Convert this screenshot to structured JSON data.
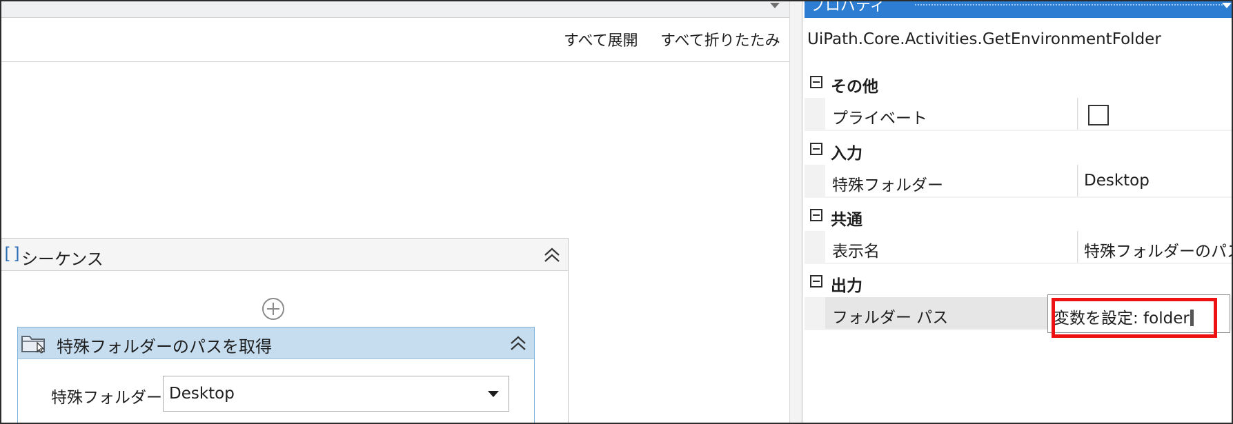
{
  "designer": {
    "expand_all": "すべて展開",
    "collapse_all": "すべて折りたたみ",
    "sequence": {
      "bracket": "[]",
      "title": "シーケンス"
    },
    "activity": {
      "title": "特殊フォルダーのパスを取得",
      "field_label": "特殊フォルダー",
      "field_value": "Desktop"
    }
  },
  "properties": {
    "panel_title": "プロパティ",
    "activity_type": "UiPath.Core.Activities.GetEnvironmentFolder",
    "categories": [
      {
        "label": "その他",
        "props": [
          {
            "name": "プライベート",
            "kind": "checkbox",
            "checked": false
          }
        ]
      },
      {
        "label": "入力",
        "props": [
          {
            "name": "特殊フォルダー",
            "value": "Desktop"
          }
        ]
      },
      {
        "label": "共通",
        "props": [
          {
            "name": "表示名",
            "value": "特殊フォルダーのパス"
          }
        ]
      },
      {
        "label": "出力",
        "props": [
          {
            "name": "フォルダー パス",
            "editor_value": "変数を設定:  folder"
          }
        ]
      }
    ]
  },
  "colors": {
    "titlebar": "#2d7dd2",
    "activity_header": "#c6ddf0",
    "highlight": "#ee1111",
    "sequence_bracket": "#2d6fb6"
  },
  "icons": {
    "collapse": "double-chevron-up-icon",
    "add": "plus-circle-icon",
    "activity": "folder-cursor-icon",
    "dropdown": "triangle-down-icon",
    "category_toggle": "minus-box-icon"
  }
}
